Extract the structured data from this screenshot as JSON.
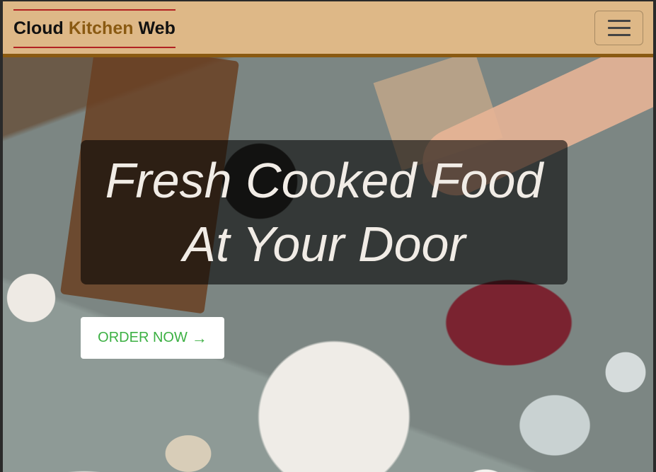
{
  "navbar": {
    "brand": {
      "part1": "Cloud",
      "part2": "Kitchen",
      "part3": "Web"
    },
    "toggler_icon": "hamburger-menu-icon"
  },
  "hero": {
    "background_image": "food-table-photo",
    "headline_line1": "Fresh Cooked Food",
    "headline_line2": "At Your Door",
    "cta_label": "ORDER NOW",
    "cta_icon": "→"
  },
  "colors": {
    "navbar_bg": "#deb887",
    "brand_accent": "#8a5a12",
    "brand_rule": "#b22222",
    "cta_text": "#3cb043"
  }
}
